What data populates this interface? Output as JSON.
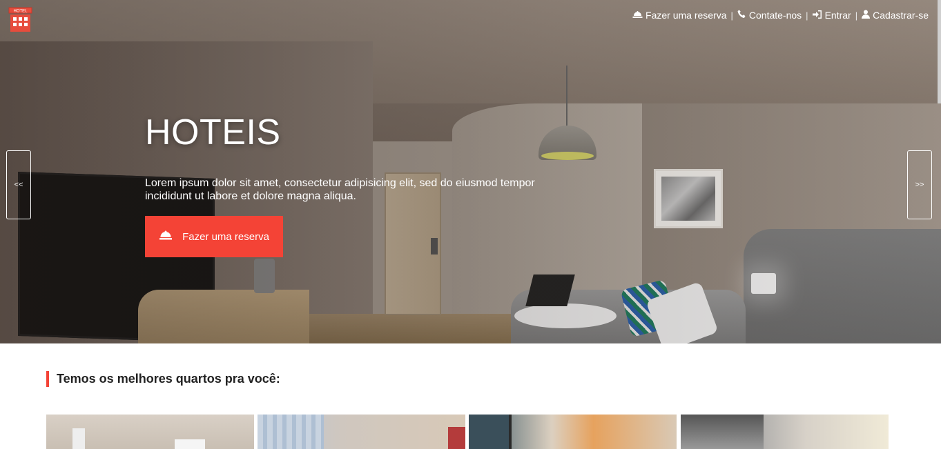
{
  "nav": {
    "items": [
      {
        "label": "Fazer uma reserva",
        "icon": "bell-icon"
      },
      {
        "label": "Contate-nos",
        "icon": "phone-icon"
      },
      {
        "label": "Entrar",
        "icon": "sign-in-icon"
      },
      {
        "label": "Cadastrar-se",
        "icon": "user-icon"
      }
    ],
    "separator": "|"
  },
  "logo": {
    "text": "HOTEL",
    "icon": "hotel-logo-icon"
  },
  "hero": {
    "title": "HOTEIS",
    "description": "Lorem ipsum dolor sit amet, consectetur adipisicing elit, sed do eiusmod tempor incididunt ut labore et dolore magna aliqua.",
    "cta_label": "Fazer uma reserva",
    "prev_label": "<<",
    "next_label": ">>"
  },
  "section": {
    "title": "Temos os melhores quartos pra você:"
  },
  "colors": {
    "accent": "#f44336",
    "text": "#222222",
    "white": "#ffffff"
  }
}
